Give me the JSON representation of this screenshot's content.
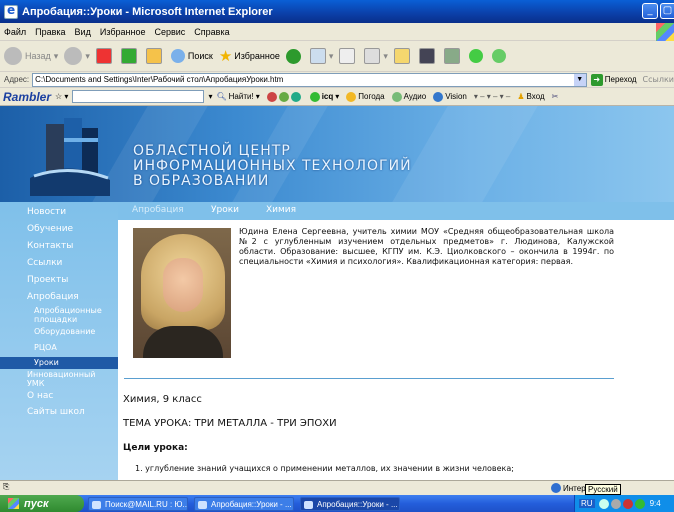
{
  "window": {
    "title": "Апробация::Уроки - Microsoft Internet Explorer",
    "minimize_label": "_",
    "maximize_label": "▢"
  },
  "menu": [
    "Файл",
    "Правка",
    "Вид",
    "Избранное",
    "Сервис",
    "Справка"
  ],
  "toolbar": {
    "back_label": "Назад",
    "search_label": "Поиск",
    "favorites_label": "Избранное"
  },
  "address": {
    "label": "Адрес:",
    "value": "C:\\Documents and Settings\\Inter\\Рабочий стол\\АпробацияУроки.htm",
    "go_label": "Переход",
    "links_label": "Ссылки"
  },
  "rambler": {
    "logo": "Rambler",
    "find_label": "Найти!",
    "icq_label": "icq",
    "weather_label": "Погода",
    "audio_label": "Аудио",
    "vision_label": "Vision",
    "login_label": "Вход"
  },
  "site": {
    "header_lines": [
      "ОБЛАСТНОЙ ЦЕНТР",
      "ИНФОРМАЦИОННЫХ ТЕХНОЛОГИЙ",
      "В ОБРАЗОВАНИИ"
    ],
    "sidebar": [
      {
        "label": "Новости"
      },
      {
        "label": "Обучение"
      },
      {
        "label": "Контакты"
      },
      {
        "label": "Ссылки"
      },
      {
        "label": "Проекты"
      },
      {
        "label": "Апробация"
      },
      {
        "label": "Апробационные площадки",
        "sub": true
      },
      {
        "label": "Оборудование",
        "sub": true
      },
      {
        "label": "РЦОА",
        "sub": true
      },
      {
        "label": "Уроки",
        "sub": true,
        "active": true
      },
      {
        "label": "Инновационный УМК"
      },
      {
        "label": "О нас"
      },
      {
        "label": "Сайты школ"
      }
    ],
    "breadcrumb": [
      "Апробация",
      "Уроки",
      "Химия"
    ],
    "bio": "Юдина Елена Сергеевна, учитель химии МОУ «Средняя общеобразовательная школа №2 с углубленным изучением отдельных предметов» г. Людинова, Калужской области. Образование: высшее, КГПУ им. К.Э. Циолковского – окончила в 1994г. по специальности «Химия и психология». Квалификационная категория: первая.",
    "class_title": "Химия, 9 класс",
    "lesson_topic": "ТЕМА УРОКА: ТРИ МЕТАЛЛА - ТРИ ЭПОХИ",
    "goals_title": "Цели урока:",
    "goal_1": "1.   углубление знаний учащихся о применении металлов, их значении в жизни человека;"
  },
  "status": {
    "zone_label": "Интернет",
    "tooltip": "Русский"
  },
  "taskbar": {
    "start_label": "пуск",
    "tasks": [
      "Поиск@MAIL.RU : Ю...",
      "Апробация::Уроки - ...",
      "Апробация::Уроки - ..."
    ],
    "lang": "RU",
    "time": "9:4"
  },
  "colors": {
    "sidebar_bg": "#7fc0ea",
    "sidebar_active": "#1f5aa6",
    "banner": "#1c5fa8"
  }
}
